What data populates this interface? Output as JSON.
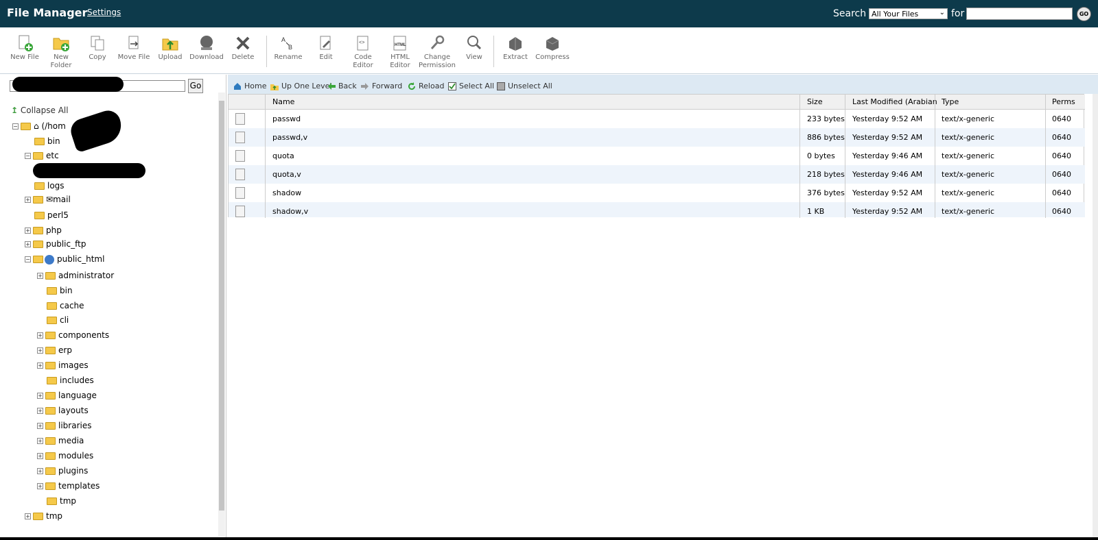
{
  "header": {
    "title": "File Manager",
    "settings_label": "Settings",
    "search_label": "Search",
    "search_scope": "All Your Files",
    "for_label": "for",
    "search_value": "",
    "go_label": "GO"
  },
  "toolbar": {
    "items": [
      {
        "label": "New File",
        "icon": "new-file-icon"
      },
      {
        "label": "New Folder",
        "icon": "new-folder-icon"
      },
      {
        "label": "Copy",
        "icon": "copy-icon"
      },
      {
        "label": "Move File",
        "icon": "move-file-icon"
      },
      {
        "label": "Upload",
        "icon": "upload-icon"
      },
      {
        "label": "Download",
        "icon": "download-icon"
      },
      {
        "label": "Delete",
        "icon": "delete-icon"
      },
      {
        "label": "Rename",
        "icon": "rename-icon"
      },
      {
        "label": "Edit",
        "icon": "edit-icon"
      },
      {
        "label": "Code Editor",
        "icon": "code-editor-icon"
      },
      {
        "label": "HTML Editor",
        "icon": "html-editor-icon"
      },
      {
        "label": "Change Permission",
        "icon": "permission-icon"
      },
      {
        "label": "View",
        "icon": "view-icon"
      },
      {
        "label": "Extract",
        "icon": "extract-icon"
      },
      {
        "label": "Compress",
        "icon": "compress-icon"
      }
    ]
  },
  "tree": {
    "go_label": "Go",
    "collapse_label": "Collapse All",
    "root_label": "(/hom",
    "nodes": [
      {
        "label": "bin"
      },
      {
        "label": "etc"
      },
      {
        "label": "logs"
      },
      {
        "label": "mail"
      },
      {
        "label": "perl5"
      },
      {
        "label": "php"
      },
      {
        "label": "public_ftp"
      },
      {
        "label": "public_html"
      },
      {
        "label": "administrator"
      },
      {
        "label": "bin"
      },
      {
        "label": "cache"
      },
      {
        "label": "cli"
      },
      {
        "label": "components"
      },
      {
        "label": "erp"
      },
      {
        "label": "images"
      },
      {
        "label": "includes"
      },
      {
        "label": "language"
      },
      {
        "label": "layouts"
      },
      {
        "label": "libraries"
      },
      {
        "label": "media"
      },
      {
        "label": "modules"
      },
      {
        "label": "plugins"
      },
      {
        "label": "templates"
      },
      {
        "label": "tmp"
      },
      {
        "label": "tmp"
      }
    ]
  },
  "nav": {
    "home": "Home",
    "up": "Up One Level",
    "back": "Back",
    "forward": "Forward",
    "reload": "Reload",
    "select_all": "Select All",
    "unselect_all": "Unselect All"
  },
  "table": {
    "headers": {
      "name": "Name",
      "size": "Size",
      "modified": "Last Modified (Arabian S",
      "type": "Type",
      "perms": "Perms"
    },
    "rows": [
      {
        "name": "passwd",
        "size": "233 bytes",
        "modified": "Yesterday 9:52 AM",
        "type": "text/x-generic",
        "perms": "0640"
      },
      {
        "name": "passwd,v",
        "size": "886 bytes",
        "modified": "Yesterday 9:52 AM",
        "type": "text/x-generic",
        "perms": "0640"
      },
      {
        "name": "quota",
        "size": "0 bytes",
        "modified": "Yesterday 9:46 AM",
        "type": "text/x-generic",
        "perms": "0640"
      },
      {
        "name": "quota,v",
        "size": "218 bytes",
        "modified": "Yesterday 9:46 AM",
        "type": "text/x-generic",
        "perms": "0640"
      },
      {
        "name": "shadow",
        "size": "376 bytes",
        "modified": "Yesterday 9:52 AM",
        "type": "text/x-generic",
        "perms": "0640"
      },
      {
        "name": "shadow,v",
        "size": "1 KB",
        "modified": "Yesterday 9:52 AM",
        "type": "text/x-generic",
        "perms": "0640"
      }
    ]
  },
  "colors": {
    "header_bg": "#0d3a4b",
    "nav_bg": "#dde9f3",
    "row_alt": "#eef4fb",
    "folder": "#f5c94a"
  }
}
